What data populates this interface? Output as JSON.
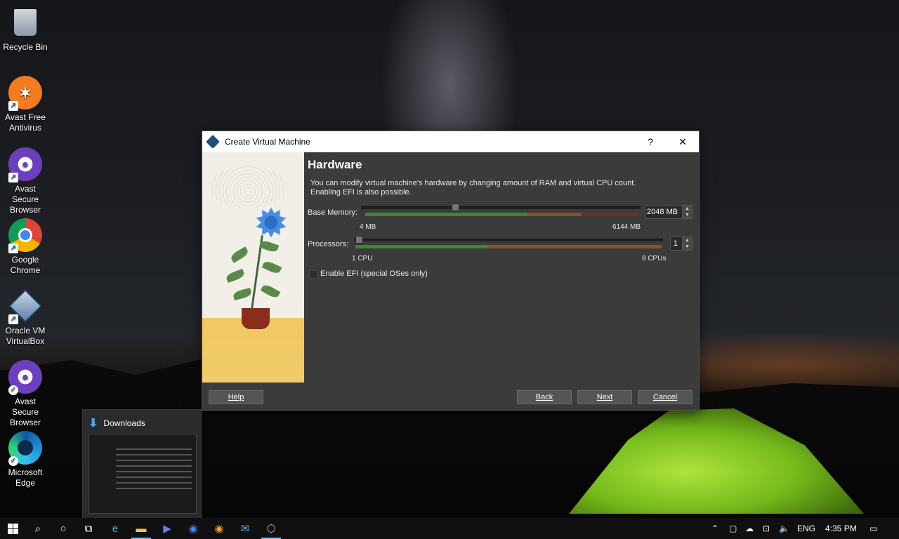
{
  "desktop": {
    "icons": [
      {
        "label": "Recycle Bin",
        "glyph": "🗑",
        "color": "#5d8fc4"
      },
      {
        "label": "Avast Free Antivirus",
        "glyph": "✶",
        "color": "#f47b20"
      },
      {
        "label": "Avast Secure Browser",
        "glyph": "🔒",
        "color": "#6a3fc0"
      },
      {
        "label": "Google Chrome",
        "glyph": "●",
        "color": "#4285f4"
      },
      {
        "label": "Oracle VM VirtualBox",
        "glyph": "⬡",
        "color": "#2d5f8a"
      },
      {
        "label": "Avast Secure Browser",
        "glyph": "🔒",
        "color": "#6a3fc0"
      },
      {
        "label": "Microsoft Edge",
        "glyph": "e",
        "color": "#1b8fd8"
      }
    ]
  },
  "dialog": {
    "title": "Create Virtual Machine",
    "help_glyph": "?",
    "close_glyph": "✕",
    "heading": "Hardware",
    "description_line1": "You can modify virtual machine's hardware by changing amount of RAM and virtual CPU count.",
    "description_line2": "Enabling EFI is also possible.",
    "memory": {
      "label": "Base Memory:",
      "value": "2048 MB",
      "value_fraction": 0.333,
      "min_label": "4 MB",
      "max_label": "6144 MB"
    },
    "processors": {
      "label": "Processors:",
      "value": "1",
      "value_fraction": 0.0,
      "min_label": "1 CPU",
      "max_label": "8 CPUs"
    },
    "efi": {
      "label": "Enable EFI (special OSes only)",
      "checked": false
    },
    "buttons": {
      "help": "Help",
      "back": "Back",
      "next": "Next",
      "cancel": "Cancel"
    }
  },
  "downloads_thumbnail": {
    "title": "Downloads"
  },
  "taskbar": {
    "tray": {
      "language": "ENG",
      "time": "4:35 PM"
    }
  }
}
